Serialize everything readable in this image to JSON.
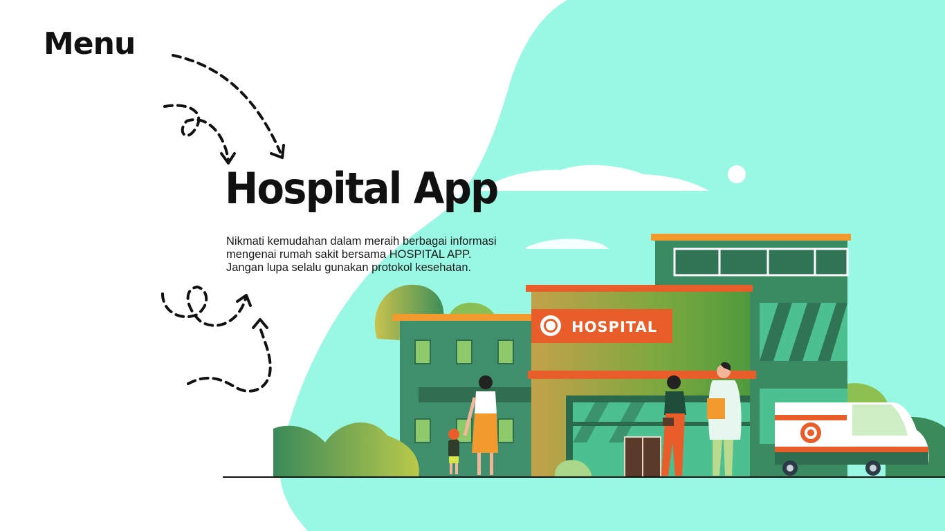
{
  "menu": {
    "label": "Menu"
  },
  "hero": {
    "title": "Hospital App",
    "description_lines": [
      "Nikmati kemudahan dalam meraih berbagai informasi",
      "mengenai rumah sakit bersama HOSPITAL APP.",
      "Jangan lupa selalu gunakan protokol kesehatan."
    ]
  },
  "illustration": {
    "hospital_sign": "HOSPITAL"
  },
  "colors": {
    "blob": "#99f8e3",
    "accent_orange": "#e85d2a",
    "roof_orange": "#f29a2e",
    "building_green": "#3f8f6c",
    "dark_green": "#2f7455",
    "text": "#111111"
  }
}
